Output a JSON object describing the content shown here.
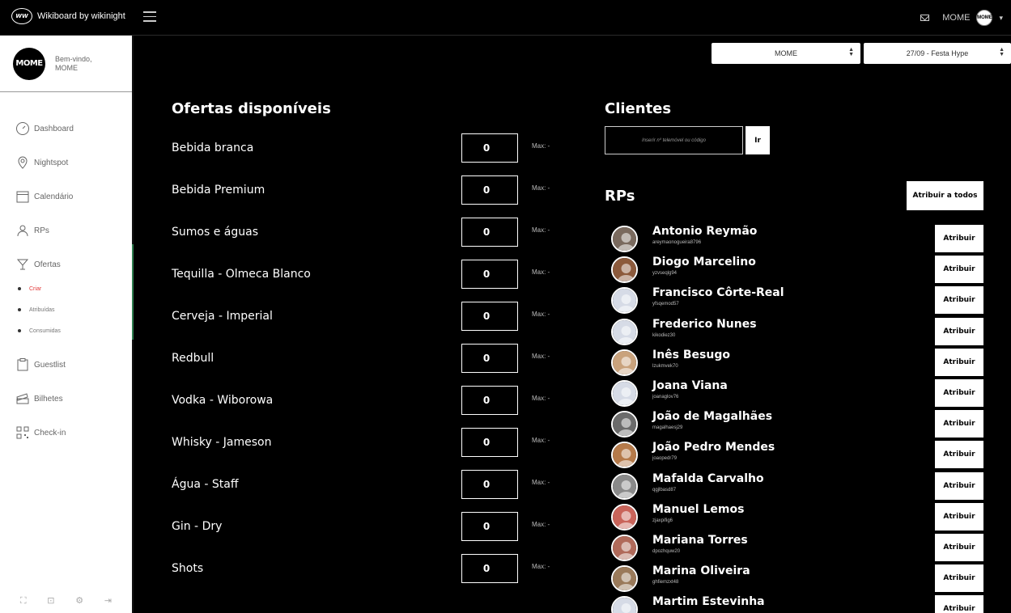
{
  "topbar": {
    "brand_logo": "WW",
    "brand": "Wikiboard by wikinight",
    "user_name": "MOME",
    "user_avatar": "MOME"
  },
  "sidebar": {
    "welcome_logo": "MOME",
    "welcome_line1": "Bem-vindo,",
    "welcome_line2": "MOME",
    "items": [
      {
        "label": "Dashboard",
        "icon": "gauge-icon"
      },
      {
        "label": "Nightspot",
        "icon": "map-pin-icon"
      },
      {
        "label": "Calendário",
        "icon": "calendar-icon"
      },
      {
        "label": "RPs",
        "icon": "user-group-icon"
      },
      {
        "label": "Ofertas",
        "icon": "cocktail-icon"
      },
      {
        "label": "Guestlist",
        "icon": "clipboard-icon"
      },
      {
        "label": "Bilhetes",
        "icon": "ticket-icon"
      },
      {
        "label": "Check-in",
        "icon": "qr-code-icon"
      }
    ],
    "subitems": [
      "Criar",
      "Atribuídas",
      "Consumidas"
    ],
    "footer_icons": [
      "fullscreen-icon",
      "lock-icon",
      "settings-icon",
      "logout-icon"
    ]
  },
  "selects": {
    "venue": "MOME",
    "event": "27/09 - Festa Hype"
  },
  "offers": {
    "title": "Ofertas disponíveis",
    "max_label": "Max: -",
    "items": [
      {
        "name": "Bebida branca",
        "qty": "0"
      },
      {
        "name": "Bebida Premium",
        "qty": "0"
      },
      {
        "name": "Sumos e águas",
        "qty": "0"
      },
      {
        "name": "Tequilla - Olmeca Blanco",
        "qty": "0"
      },
      {
        "name": "Cerveja - Imperial",
        "qty": "0"
      },
      {
        "name": "Redbull",
        "qty": "0"
      },
      {
        "name": "Vodka - Wiborowa",
        "qty": "0"
      },
      {
        "name": "Whisky - Jameson",
        "qty": "0"
      },
      {
        "name": "Água - Staff",
        "qty": "0"
      },
      {
        "name": "Gin - Dry",
        "qty": "0"
      },
      {
        "name": "Shots",
        "qty": "0"
      }
    ]
  },
  "clients": {
    "title": "Clientes",
    "placeholder": "Inserir nº telemóvel ou código",
    "button": "Ir"
  },
  "rps": {
    "title": "RPs",
    "assign_all": "Atribuir a todos",
    "assign_label": "Atribuir",
    "items": [
      {
        "name": "Antonio Reymão",
        "handle": "areymaonogueira8796",
        "color": "#7a6a5e"
      },
      {
        "name": "Diogo Marcelino",
        "handle": "yzvseqlg94",
        "color": "#8c5a3c"
      },
      {
        "name": "Francisco Côrte-Real",
        "handle": "yfsqemod57",
        "color": "#d6dbe6"
      },
      {
        "name": "Frederico Nunes",
        "handle": "kikodiez30",
        "color": "#d6dbe6"
      },
      {
        "name": "Inês Besugo",
        "handle": "lzukmvek70",
        "color": "#c9a27c"
      },
      {
        "name": "Joana Viana",
        "handle": "joanaglov76",
        "color": "#d6dbe6"
      },
      {
        "name": "João de Magalhães",
        "handle": "magalhaesj29",
        "color": "#6b6b6b"
      },
      {
        "name": "João Pedro Mendes",
        "handle": "joaopedr79",
        "color": "#b57a4a"
      },
      {
        "name": "Mafalda Carvalho",
        "handle": "qgjlbasd87",
        "color": "#8a8a8a"
      },
      {
        "name": "Manuel Lemos",
        "handle": "zjaxpifig6",
        "color": "#c9645a"
      },
      {
        "name": "Mariana Torres",
        "handle": "dpozhquw20",
        "color": "#b06a5a"
      },
      {
        "name": "Marina Oliveira",
        "handle": "ghfiemzxt48",
        "color": "#9a7a5a"
      },
      {
        "name": "Martim Estevinha",
        "handle": "",
        "color": "#d6dbe6"
      }
    ]
  }
}
